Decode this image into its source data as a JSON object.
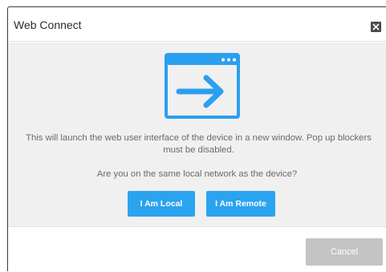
{
  "dialog": {
    "title": "Web Connect",
    "close_icon": "close-icon"
  },
  "body": {
    "icon": "launch-window-arrow-icon",
    "message": "This will launch the web user interface of the device in a new window. Pop up blockers must be disabled.",
    "question": "Are you on the same local network as the device?",
    "buttons": {
      "local_label": "I Am Local",
      "remote_label": "I Am Remote"
    }
  },
  "footer": {
    "cancel_label": "Cancel"
  },
  "colors": {
    "accent": "#2aa4ef",
    "icon": "#2b9ff0",
    "cancel_disabled": "#c4c4c4",
    "body_background": "#f0f0f0"
  }
}
